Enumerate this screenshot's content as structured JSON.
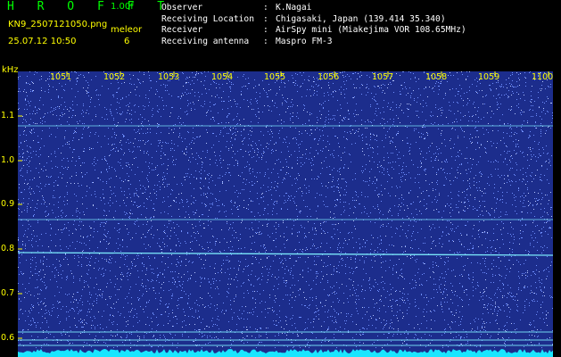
{
  "header": {
    "app_title": "H R O F F T",
    "version": "1.00f",
    "filename": "KN9_2507121050.png",
    "program": "meleor",
    "timestamp": "25.07.12 10:50",
    "count": "6"
  },
  "meta": [
    {
      "label": "Observer",
      "value": "K.Nagai"
    },
    {
      "label": "Receiving Location",
      "value": "Chigasaki, Japan (139.414 35.340)"
    },
    {
      "label": "Receiver",
      "value": "AirSpy mini (Miakejima VOR 108.65MHz)"
    },
    {
      "label": "Receiving antenna",
      "value": "Maspro FM-3"
    }
  ],
  "meta_separator": ":",
  "axis": {
    "y_unit": "kHz",
    "y_ticks": [
      "1.1",
      "1.0",
      "0.9",
      "0.8",
      "0.7",
      "0.6"
    ],
    "x_ticks": [
      "1051",
      "1052",
      "1053",
      "1054",
      "1055",
      "1056",
      "1057",
      "1058",
      "1059",
      "1100"
    ]
  },
  "colors": {
    "background": "#1c2d8c",
    "noise": "#6f8fff",
    "signal_line": "#7ff0ff",
    "label": "#ffff00",
    "title": "#00ff00"
  }
}
